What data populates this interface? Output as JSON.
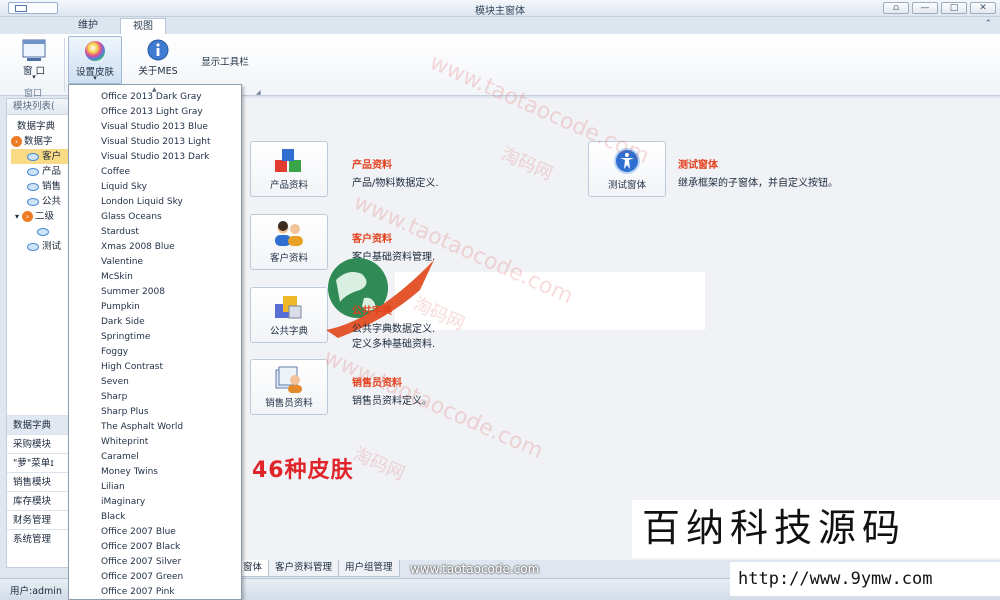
{
  "window": {
    "title": "模块主窗体",
    "controls": [
      "⩍",
      "—",
      "□",
      "✕"
    ],
    "collapse_glyph": "⌃"
  },
  "ribbon": {
    "tabs": [
      {
        "label": "维护",
        "active": false
      },
      {
        "label": "视图",
        "active": true
      }
    ],
    "buttons": {
      "window": {
        "label": "窗 口",
        "dropdown": "▾"
      },
      "skin": {
        "label": "设置皮肤",
        "dropdown": "▾"
      },
      "about": {
        "label": "关于MES"
      },
      "toolbar": {
        "label": "显示工具栏"
      }
    },
    "group_labels": {
      "window": "窗口",
      "corner": "◢"
    }
  },
  "left_panel": {
    "header": "模块列表(",
    "tree": [
      {
        "label": "数据字典",
        "level": 0,
        "kind": "text"
      },
      {
        "label": "数据字",
        "level": 0,
        "kind": "orange",
        "glyph": "›"
      },
      {
        "label": "客户",
        "level": 1,
        "kind": "blue",
        "selected": true
      },
      {
        "label": "产品",
        "level": 1,
        "kind": "blue"
      },
      {
        "label": "销售",
        "level": 1,
        "kind": "blue"
      },
      {
        "label": "公共",
        "level": 1,
        "kind": "blue"
      },
      {
        "label": "二级",
        "level": 0,
        "kind": "orange",
        "glyph": "›",
        "expander": "▾"
      },
      {
        "label": "",
        "level": 2,
        "kind": "blue"
      },
      {
        "label": "测试",
        "level": 1,
        "kind": "blue"
      }
    ],
    "nav": [
      {
        "label": "数据字典",
        "selected": true
      },
      {
        "label": "采购模块"
      },
      {
        "label": "\"萝\"菜单ɪ"
      },
      {
        "label": "销售模块"
      },
      {
        "label": "库存模块"
      },
      {
        "label": "财务管理"
      },
      {
        "label": "系统管理"
      }
    ]
  },
  "skin_menu": {
    "open_glyph": "▲",
    "items": [
      "Office 2013 Dark Gray",
      "Office 2013 Light Gray",
      "Visual Studio 2013 Blue",
      "Visual Studio 2013 Light",
      "Visual Studio 2013 Dark",
      "Coffee",
      "Liquid Sky",
      "London Liquid Sky",
      "Glass Oceans",
      "Stardust",
      "Xmas 2008 Blue",
      "Valentine",
      "McSkin",
      "Summer 2008",
      "Pumpkin",
      "Dark Side",
      "Springtime",
      "Foggy",
      "High Contrast",
      "Seven",
      "Sharp",
      "Sharp Plus",
      "The Asphalt World",
      "Whiteprint",
      "Caramel",
      "Money Twins",
      "Lilian",
      "iMaginary",
      "Black",
      "Office 2007 Blue",
      "Office 2007 Black",
      "Office 2007 Silver",
      "Office 2007 Green",
      "Office 2007 Pink"
    ]
  },
  "tiles": [
    {
      "key": "product",
      "label": "产品资料",
      "title": "产品资料",
      "desc": "产品/物料数据定义."
    },
    {
      "key": "customer",
      "label": "客户资料",
      "title": "客户资料",
      "desc": "客户基础资料管理."
    },
    {
      "key": "common",
      "label": "公共字典",
      "title": "公共字典",
      "desc": "公共字典数据定义.",
      "desc2": "定义多种基础资料."
    },
    {
      "key": "sales",
      "label": "销售员资料",
      "title": "销售员资料",
      "desc": "销售员资料定义。"
    },
    {
      "key": "test",
      "label": "测试窗体",
      "title": "测试窗体",
      "desc": "继承框架的子窗体，并自定义按钮。"
    }
  ],
  "skin_badge": "46种皮肤",
  "bottom_tabs": [
    {
      "label": "窗体",
      "active": true
    },
    {
      "label": "客户资料管理",
      "active": false
    },
    {
      "label": "用户组管理",
      "active": false
    }
  ],
  "status": {
    "user": "用户:admin"
  },
  "watermarks": {
    "site": "www.taotaocode.com",
    "cn": "淘码网",
    "url_strip": "www.taotaocode.com",
    "brand_cn": "百纳科技源码",
    "brand_url": "http://www.9ymw.com"
  },
  "colors": {
    "accent_red": "#e3421e",
    "badge_red": "#e0252a",
    "tree_orange": "#ec7b23",
    "selection": "#f9db86"
  }
}
